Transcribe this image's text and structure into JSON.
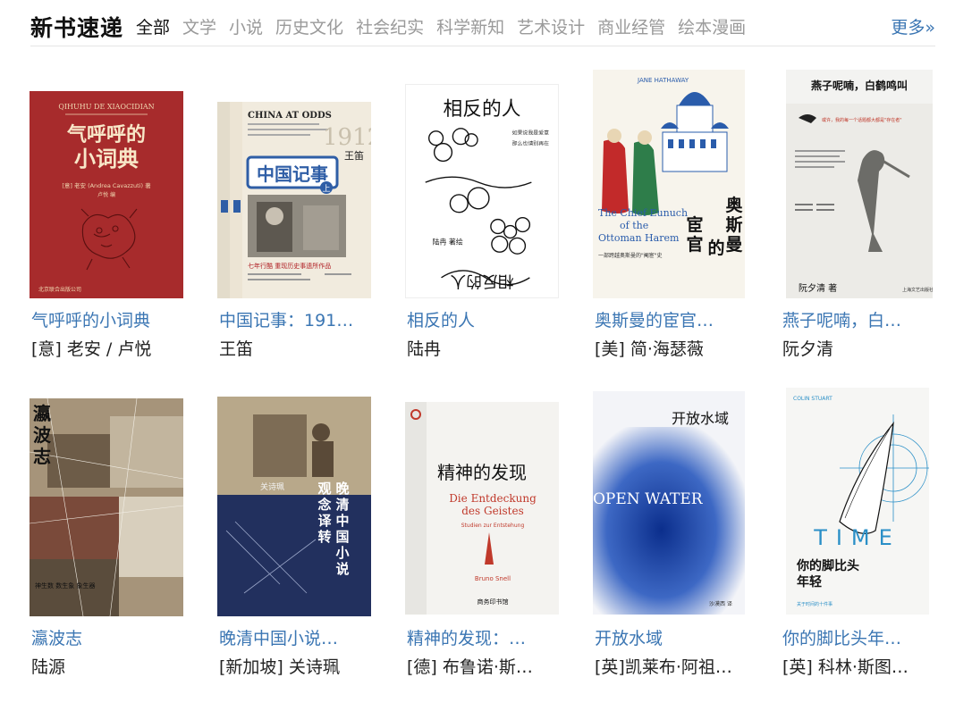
{
  "header": {
    "title": "新书速递",
    "tabs": [
      "全部",
      "文学",
      "小说",
      "历史文化",
      "社会纪实",
      "科学新知",
      "艺术设计",
      "商业经管",
      "绘本漫画"
    ],
    "more": "更多»"
  },
  "books": [
    {
      "title": "气呼呼的小词典",
      "author": "[意] 老安 / 卢悦",
      "cover": {
        "t1": "QIHUHU DE XIAOCIDIAN",
        "t2": "气呼呼的",
        "t3": "小词典",
        "t4": "[意] 老安 (Andrea Cavazzuti) 著",
        "t5": "卢悦 编"
      }
    },
    {
      "title": "中国记事：191…",
      "author": "王笛",
      "cover": {
        "t1": "CHINA AT ODDS",
        "t2": "中国记事",
        "t3": "上",
        "t4": "王笛",
        "t5": "1912",
        "t6": "七年行酷 重现历史事遗所作品"
      }
    },
    {
      "title": "相反的人",
      "author": "陆冉",
      "cover": {
        "t1": "相反的人",
        "t2": "陆冉 著绘"
      }
    },
    {
      "title": "奥斯曼的宦官…",
      "author": "[美] 简·海瑟薇",
      "cover": {
        "t1": "JANE HATHAWAY",
        "t2": "The Chief Eunuch of the Ottoman Harem",
        "t3": "奥斯曼的宦官"
      }
    },
    {
      "title": "燕子呢喃，白…",
      "author": "阮夕清",
      "cover": {
        "t1": "燕子呢喃，白鹤鸣叫",
        "t2": "阮夕清 著"
      }
    },
    {
      "title": "瀛波志",
      "author": "陆源",
      "cover": {
        "t1": "瀛波志",
        "t2": "神生数 数生象 象生器"
      }
    },
    {
      "title": "晚清中国小说…",
      "author": "[新加坡] 关诗珮",
      "cover": {
        "t1": "关诗珮",
        "t2": "晚清中国小说观念译转"
      }
    },
    {
      "title": "精神的发现：…",
      "author": "[德] 布鲁诺·斯…",
      "cover": {
        "t1": "精神的发现",
        "t2": "Die Entdeckung des Geistes",
        "t3": "Bruno Snell",
        "t4": "商务印书馆"
      }
    },
    {
      "title": "开放水域",
      "author": "[英]凯莱布·阿祖…",
      "cover": {
        "t1": "开放水域",
        "t2": "OPEN WATER"
      }
    },
    {
      "title": "你的脚比头年…",
      "author": "[英] 科林·斯图…",
      "cover": {
        "t1": "COLIN STUART",
        "t2": "TIME",
        "t3": "你的脚比头年轻",
        "t4": "关于时间的十件事"
      }
    }
  ],
  "colors": {
    "link": "#3b76b3",
    "tab_inactive": "#9a9a9a"
  }
}
